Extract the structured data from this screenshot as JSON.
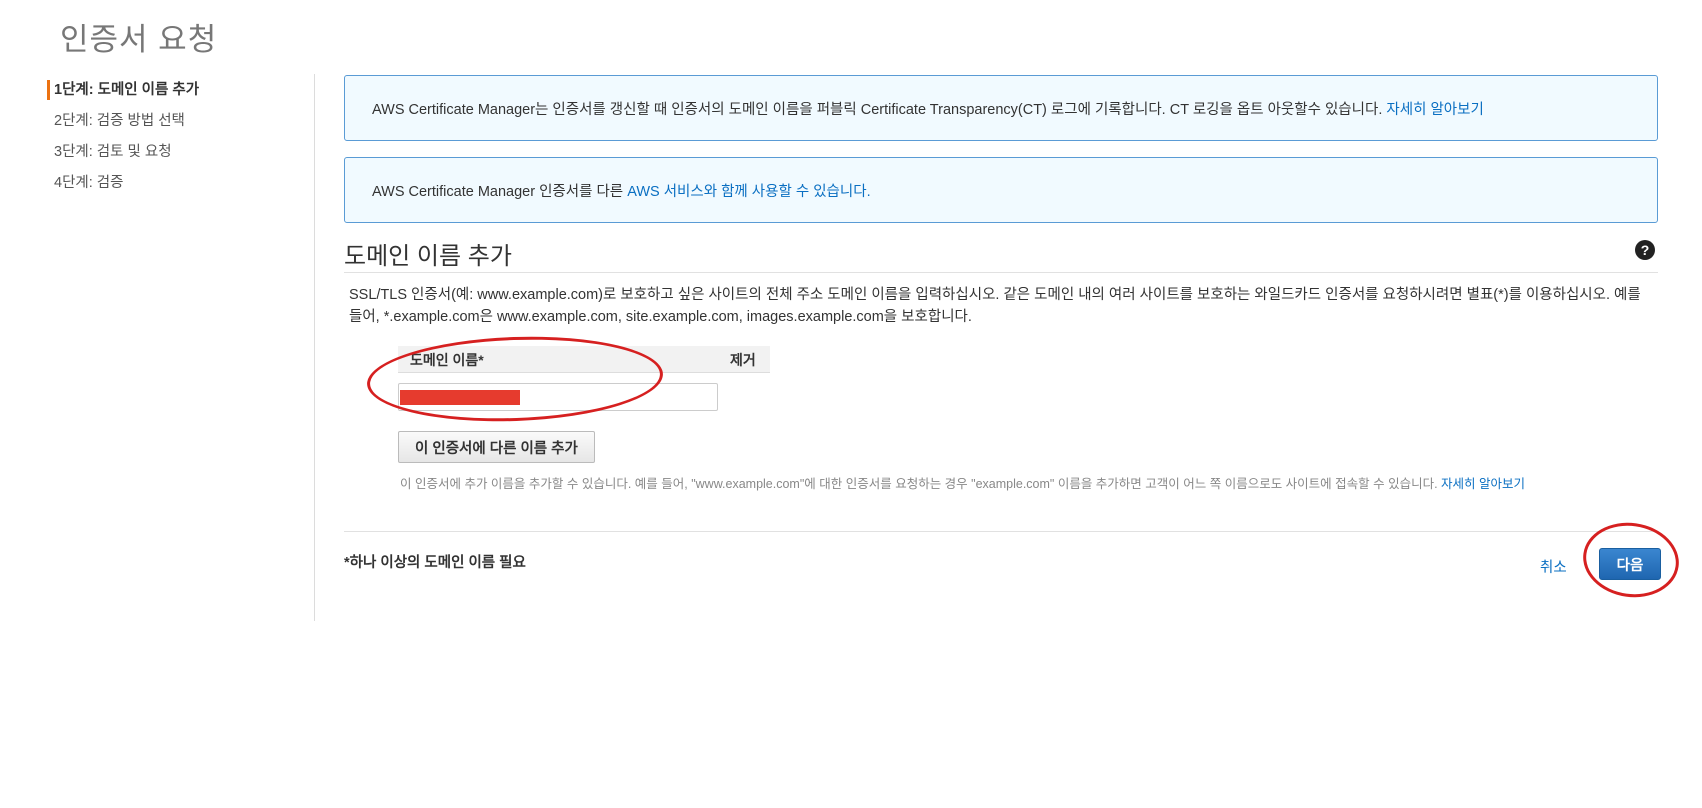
{
  "page": {
    "title": "인증서 요청"
  },
  "steps": [
    {
      "label": "1단계: 도메인 이름 추가",
      "active": true
    },
    {
      "label": "2단계: 검증 방법 선택",
      "active": false
    },
    {
      "label": "3단계: 검토 및 요청",
      "active": false
    },
    {
      "label": "4단계: 검증",
      "active": false
    }
  ],
  "info_boxes": {
    "ct_text": "AWS Certificate Manager는 인증서를 갱신할 때 인증서의 도메인 이름을 퍼블릭 Certificate Transparency(CT) 로그에 기록합니다. CT 로깅을 옵트 아웃할수 있습니다. ",
    "ct_link": "자세히 알아보기",
    "services_text": "AWS Certificate Manager 인증서를 다른 ",
    "services_link": "AWS 서비스와 함께 사용할 수 있습니다."
  },
  "section": {
    "title": "도메인 이름 추가",
    "help_icon": "question-circle-icon",
    "description": "SSL/TLS 인증서(예: www.example.com)로 보호하고 싶은 사이트의 전체 주소 도메인 이름을 입력하십시오. 같은 도메인 내의 여러 사이트를 보호하는 와일드카드 인증서를 요청하시려면 별표(*)를 이용하십시오. 예를 들어, *.example.com은 www.example.com, site.example.com, images.example.com을 보호합니다."
  },
  "domain_table": {
    "col_domain": "도메인 이름*",
    "col_remove": "제거",
    "input_value": ""
  },
  "add_name_button": "이 인증서에 다른 이름 추가",
  "hint": {
    "text": "이 인증서에 추가 이름을 추가할 수 있습니다. 예를 들어, \"www.example.com\"에 대한 인증서를 요청하는 경우 \"example.com\" 이름을 추가하면 고객이 어느 쪽 이름으로도 사이트에 접속할 수 있습니다. ",
    "link": "자세히 알아보기"
  },
  "footer": {
    "required_note": "*하나 이상의 도메인 이름 필요",
    "cancel": "취소",
    "next": "다음"
  },
  "colors": {
    "link": "#0a6fc2",
    "info_border": "#5a9bd5",
    "info_bg": "#f1faff",
    "primary_button": "#1f66b0",
    "active_step_marker": "#ec7211",
    "annotation": "#d62020",
    "redaction": "#e63b2e"
  }
}
